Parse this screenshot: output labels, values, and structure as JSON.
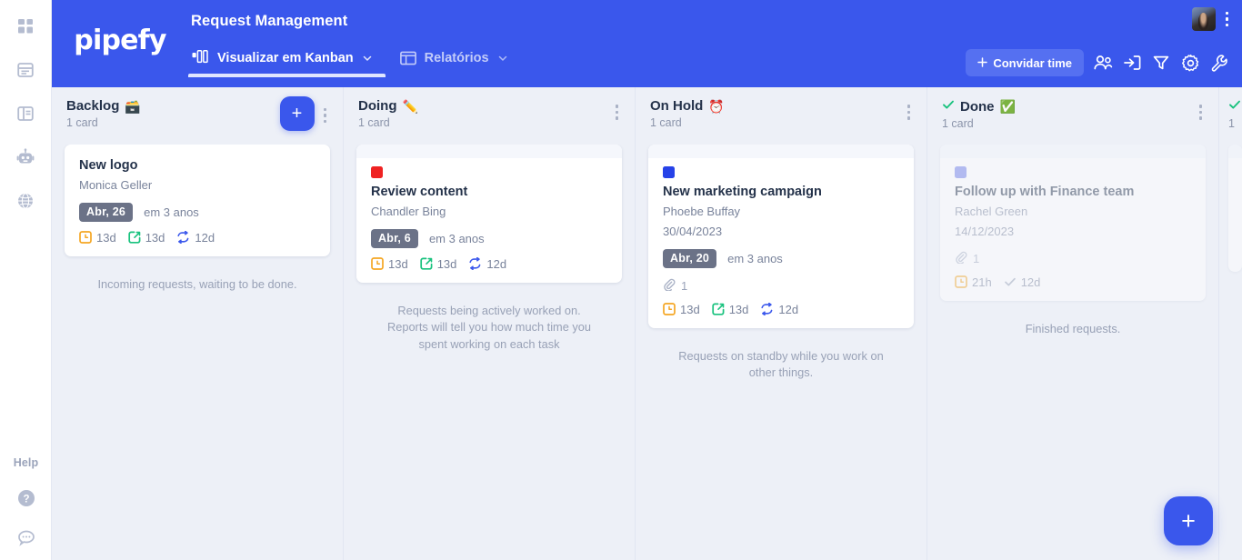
{
  "sidebar": {
    "items": [
      {
        "name": "apps-grid-icon",
        "label": "Apps"
      },
      {
        "name": "database-icon",
        "label": "Database"
      },
      {
        "name": "templates-icon",
        "label": "Templates"
      },
      {
        "name": "automation-robot-icon",
        "label": "Automations"
      },
      {
        "name": "globe-icon",
        "label": "Portal"
      }
    ],
    "help_label": "Help",
    "bottom_items": [
      {
        "name": "help-question-icon",
        "label": "Help"
      },
      {
        "name": "chat-bubble-icon",
        "label": "Chat"
      }
    ]
  },
  "header": {
    "logo": "pipefy",
    "pipe_title": "Request Management",
    "tabs": [
      {
        "label": "Visualizar em Kanban",
        "icon": "kanban-icon",
        "active": true,
        "has_chevron": true
      },
      {
        "label": "Relatórios",
        "icon": "reports-icon",
        "active": false,
        "has_chevron": true
      }
    ],
    "invite_button": "Convidar time",
    "invite_icon": "plus-sparkle-icon",
    "actions": [
      {
        "name": "members-icon",
        "label": "Members"
      },
      {
        "name": "import-icon",
        "label": "Import"
      },
      {
        "name": "filter-icon",
        "label": "Filter"
      },
      {
        "name": "settings-gear-icon",
        "label": "Settings"
      },
      {
        "name": "wrench-icon",
        "label": "Tools"
      }
    ],
    "avatar_name": "user-avatar",
    "overflow_menu": "more-options"
  },
  "board": {
    "columns": [
      {
        "title": "Backlog",
        "emoji": "🗃️",
        "count": "1 card",
        "description": "Incoming requests, waiting to be done.",
        "has_add_button": true,
        "done_check": false,
        "cards": [
          {
            "title": "New logo",
            "person": "Monica Geller",
            "date": "",
            "label_color": "",
            "due_badge": "Abr, 26",
            "due_text": "em 3 anos",
            "attachments": "",
            "dimmed": false,
            "metrics": [
              {
                "icon": "clock-orange-icon",
                "value": "13d"
              },
              {
                "icon": "phase-green-icon",
                "value": "13d"
              },
              {
                "icon": "cycle-blue-icon",
                "value": "12d"
              }
            ]
          }
        ]
      },
      {
        "title": "Doing",
        "emoji": "✏️",
        "count": "1 card",
        "description": "Requests being actively worked on. Reports will tell you how much time you spent working on each task",
        "has_add_button": false,
        "done_check": false,
        "cards": [
          {
            "title": "Review content",
            "person": "Chandler Bing",
            "date": "",
            "label_color": "#ef2222",
            "due_badge": "Abr, 6",
            "due_text": "em 3 anos",
            "attachments": "",
            "dimmed": false,
            "metrics": [
              {
                "icon": "clock-orange-icon",
                "value": "13d"
              },
              {
                "icon": "phase-green-icon",
                "value": "13d"
              },
              {
                "icon": "cycle-blue-icon",
                "value": "12d"
              }
            ]
          }
        ]
      },
      {
        "title": "On Hold",
        "emoji": "⏰",
        "count": "1 card",
        "description": "Requests on standby while you work on other things.",
        "has_add_button": false,
        "done_check": false,
        "cards": [
          {
            "title": "New marketing campaign",
            "person": "Phoebe Buffay",
            "date": "30/04/2023",
            "label_color": "#2642e8",
            "due_badge": "Abr, 20",
            "due_text": "em 3 anos",
            "attachments": "1",
            "dimmed": false,
            "metrics": [
              {
                "icon": "clock-orange-icon",
                "value": "13d"
              },
              {
                "icon": "phase-green-icon",
                "value": "13d"
              },
              {
                "icon": "cycle-blue-icon",
                "value": "12d"
              }
            ]
          }
        ]
      },
      {
        "title": "Done",
        "emoji": "✅",
        "count": "1 card",
        "description": "Finished requests.",
        "has_add_button": false,
        "done_check": true,
        "cards": [
          {
            "title": "Follow up with Finance team",
            "person": "Rachel Green",
            "date": "14/12/2023",
            "label_color": "#6b7ae8",
            "due_badge": "",
            "due_text": "",
            "attachments": "1",
            "dimmed": true,
            "metrics": [
              {
                "icon": "clock-orange-icon",
                "value": "21h"
              },
              {
                "icon": "check-gray-icon",
                "value": "12d"
              }
            ]
          }
        ]
      },
      {
        "title": "",
        "emoji": "",
        "count": "1",
        "description": "",
        "has_add_button": false,
        "done_check": true,
        "partial": true,
        "cards": []
      }
    ]
  },
  "fab": {
    "label": "+",
    "name": "create-card-fab"
  },
  "colors": {
    "brand_blue": "#3a57ec",
    "header_blue": "#3a57ec",
    "board_bg": "#edf0f7",
    "card_white": "#ffffff",
    "badge_gray": "#6b7287",
    "orange": "#f5a623",
    "green": "#19c27e",
    "blue_metric": "#3a57ec"
  }
}
